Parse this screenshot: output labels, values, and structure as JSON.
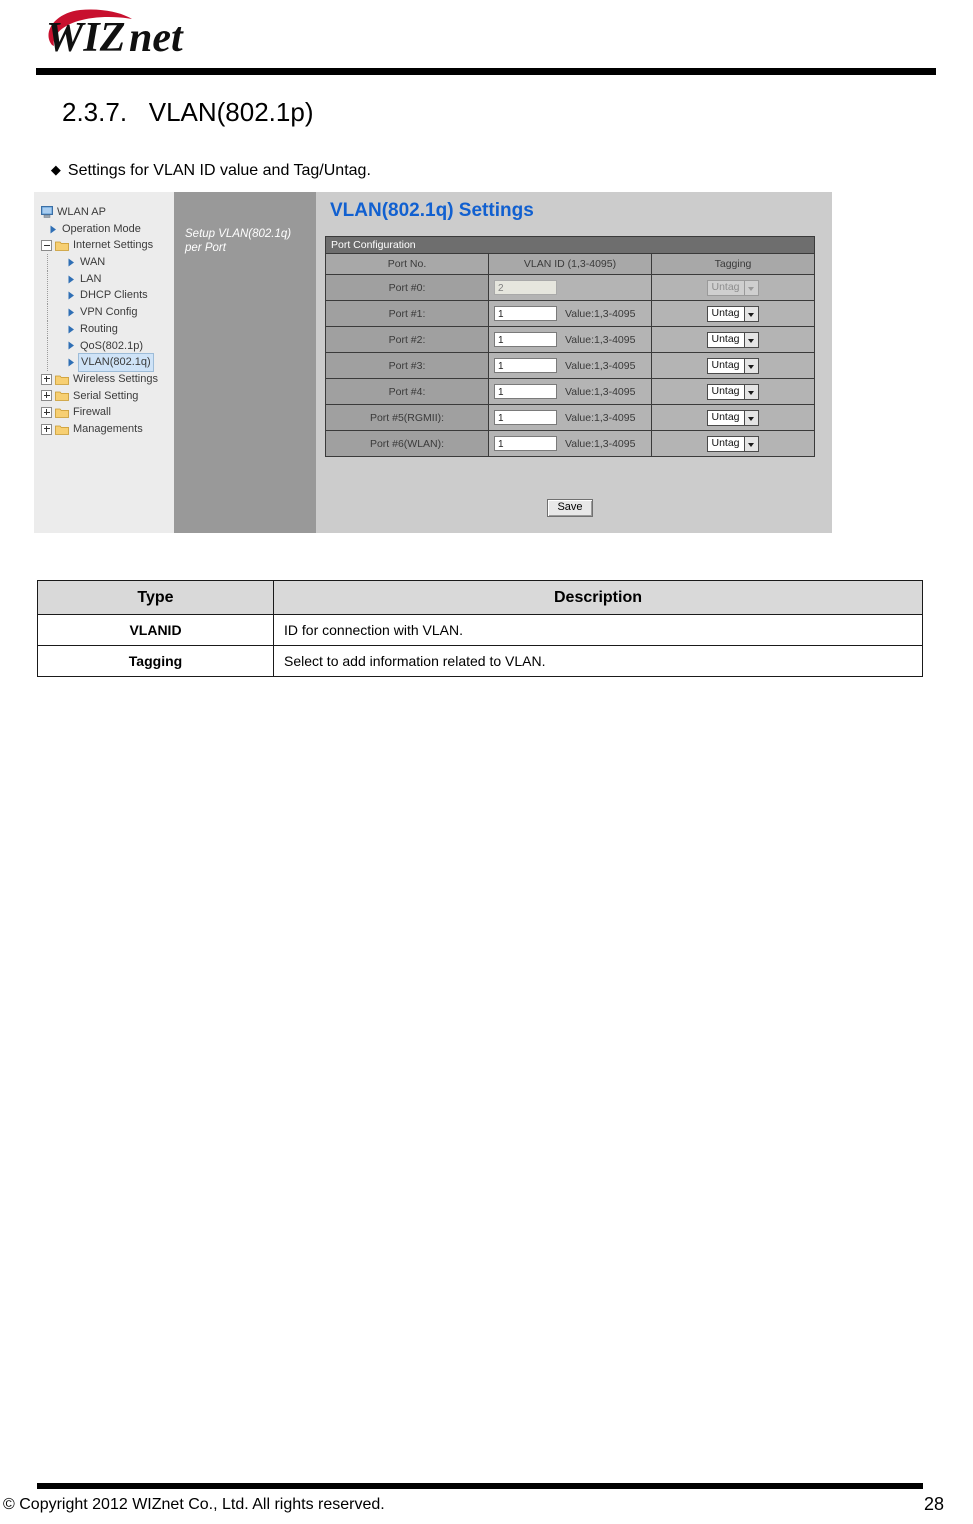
{
  "header": {
    "logo_text": "WIZnet",
    "logo_alt": "wiznet-logo"
  },
  "section": {
    "number": "2.3.7.",
    "title": "VLAN(802.1p)",
    "heading_full": "2.3.7.   VLAN(802.1p)",
    "bullet": "Settings for VLAN ID value and Tag/Untag.",
    "bullet_glyph": "◆"
  },
  "router_ui": {
    "tree": [
      {
        "label": "WLAN AP",
        "icon": "computer-icon",
        "indent": 0,
        "expander": "",
        "selected": false
      },
      {
        "label": "Operation Mode",
        "icon": "arrow-bullet-icon",
        "indent": 1,
        "expander": "",
        "selected": false
      },
      {
        "label": "Internet Settings",
        "icon": "folder-open-icon",
        "indent": 0,
        "expander": "minus",
        "selected": false
      },
      {
        "label": "WAN",
        "icon": "arrow-bullet-icon",
        "indent": 2,
        "expander": "",
        "selected": false
      },
      {
        "label": "LAN",
        "icon": "arrow-bullet-icon",
        "indent": 2,
        "expander": "",
        "selected": false
      },
      {
        "label": "DHCP Clients",
        "icon": "arrow-bullet-icon",
        "indent": 2,
        "expander": "",
        "selected": false
      },
      {
        "label": "VPN Config",
        "icon": "arrow-bullet-icon",
        "indent": 2,
        "expander": "",
        "selected": false
      },
      {
        "label": "Routing",
        "icon": "arrow-bullet-icon",
        "indent": 2,
        "expander": "",
        "selected": false
      },
      {
        "label": "QoS(802.1p)",
        "icon": "arrow-bullet-icon",
        "indent": 2,
        "expander": "",
        "selected": false
      },
      {
        "label": "VLAN(802.1q)",
        "icon": "arrow-bullet-icon",
        "indent": 2,
        "expander": "",
        "selected": true
      },
      {
        "label": "Wireless Settings",
        "icon": "folder-icon",
        "indent": 0,
        "expander": "plus",
        "selected": false
      },
      {
        "label": "Serial Setting",
        "icon": "folder-icon",
        "indent": 0,
        "expander": "plus",
        "selected": false
      },
      {
        "label": "Firewall",
        "icon": "folder-icon",
        "indent": 0,
        "expander": "plus",
        "selected": false
      },
      {
        "label": "Managements",
        "icon": "folder-icon",
        "indent": 0,
        "expander": "plus",
        "selected": false
      }
    ],
    "help_panel": "Setup VLAN(802.1q) per Port",
    "page_title": "VLAN(802.1q) Settings",
    "band_label": "Port Configuration",
    "columns": [
      "Port No.",
      "VLAN ID (1,3-4095)",
      "Tagging"
    ],
    "rows": [
      {
        "port": "Port #0:",
        "vlan_id": "2",
        "hint": "",
        "tagging": "Untag",
        "disabled": true
      },
      {
        "port": "Port #1:",
        "vlan_id": "1",
        "hint": "Value:1,3-4095",
        "tagging": "Untag",
        "disabled": false
      },
      {
        "port": "Port #2:",
        "vlan_id": "1",
        "hint": "Value:1,3-4095",
        "tagging": "Untag",
        "disabled": false
      },
      {
        "port": "Port #3:",
        "vlan_id": "1",
        "hint": "Value:1,3-4095",
        "tagging": "Untag",
        "disabled": false
      },
      {
        "port": "Port #4:",
        "vlan_id": "1",
        "hint": "Value:1,3-4095",
        "tagging": "Untag",
        "disabled": false
      },
      {
        "port": "Port #5(RGMII):",
        "vlan_id": "1",
        "hint": "Value:1,3-4095",
        "tagging": "Untag",
        "disabled": false
      },
      {
        "port": "Port #6(WLAN):",
        "vlan_id": "1",
        "hint": "Value:1,3-4095",
        "tagging": "Untag",
        "disabled": false
      }
    ],
    "save_label": "Save",
    "accent_title_color": "#1160d0"
  },
  "description_table": {
    "headers": [
      "Type",
      "Description"
    ],
    "rows": [
      {
        "type": "VLANID",
        "description": "ID for connection with VLAN."
      },
      {
        "type": "Tagging",
        "description": "Select to add information related to VLAN."
      }
    ]
  },
  "footer": {
    "copyright": "© Copyright 2012 WIZnet Co., Ltd. All rights reserved.",
    "page_number": "28"
  }
}
